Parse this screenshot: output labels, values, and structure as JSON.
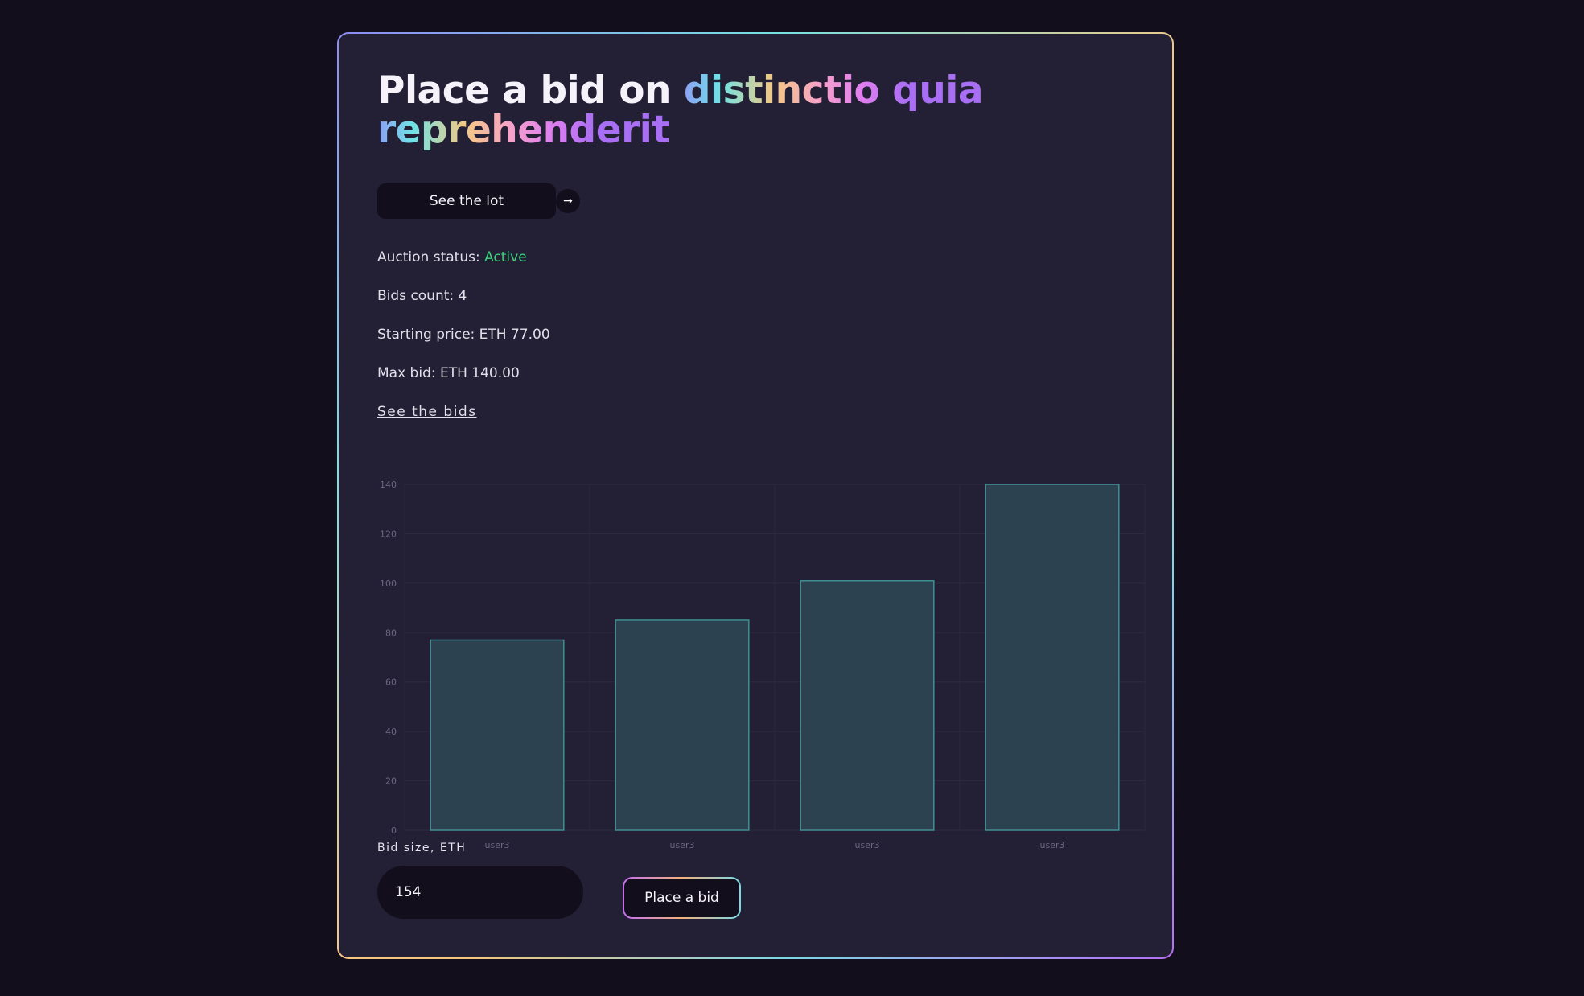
{
  "title": {
    "prefix": "Place a bid on",
    "lot_name_line1": "distinctio quia",
    "lot_name_line2": "reprehenderit"
  },
  "lot_button": {
    "label": "See the lot",
    "arrow": "→"
  },
  "status": {
    "label": "Auction status:",
    "value": "Active"
  },
  "bids_count": "Bids count: 4",
  "starting_price": "Starting price: ETH 77.00",
  "max_bid": "Max bid: ETH 140.00",
  "see_bids_link": "See the bids",
  "bid_form": {
    "label": "Bid size, ETH",
    "value": "154",
    "submit_label": "Place a bid"
  },
  "colors": {
    "background": "#130e1c",
    "card": "#232035",
    "active": "#3ed27e",
    "bar_fill": "#2c4250",
    "bar_stroke": "#3f8f93"
  },
  "chart_data": {
    "type": "bar",
    "categories": [
      "user3",
      "user3",
      "user3",
      "user3"
    ],
    "values": [
      77,
      85,
      101,
      140
    ],
    "ylim": [
      0,
      140
    ],
    "yticks": [
      0,
      20,
      40,
      60,
      80,
      100,
      120,
      140
    ],
    "grid": true,
    "title": "",
    "xlabel": "",
    "ylabel": ""
  }
}
